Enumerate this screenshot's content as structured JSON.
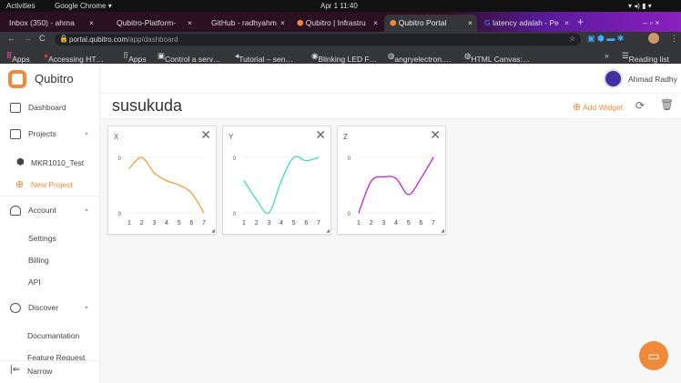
{
  "system": {
    "activities": "Activities",
    "app": "Google Chrome ▾",
    "clock": "Apr 1  11:40"
  },
  "tabs": [
    {
      "label": "Inbox (350) - ahma"
    },
    {
      "label": "Qubitro-Platform-"
    },
    {
      "label": "GitHub - radhyahm"
    },
    {
      "label": "Qubitro | Infrastru"
    },
    {
      "label": "Qubitro Portal"
    },
    {
      "label": "latency adalah - Pe"
    }
  ],
  "address": {
    "host": "portal.qubitro.com",
    "path": "/app/dashboard"
  },
  "bookmarks": [
    "Apps",
    "Accessing HT…",
    "Apps",
    "Control a serv…",
    "Tutorial – sen…",
    "Blinking LED F…",
    "angryelectron.…",
    "HTML Canvas:…"
  ],
  "reading_list": "Reading list",
  "brand": "Qubitro",
  "user": "Ahmad Radhy",
  "sidebar": {
    "dashboard": "Dashboard",
    "projects": "Projects",
    "project": "MKR1010_Test",
    "new_project": "New Project",
    "account": "Account",
    "settings": "Settings",
    "billing": "Billing",
    "api": "API",
    "discover": "Discover",
    "documentation": "Documantation",
    "feature": "Feature Request",
    "narrow": "Narrow"
  },
  "dashboard": {
    "title": "susukuda",
    "add_widget": "Add Widget"
  },
  "colors": {
    "accent": "#f08a3a"
  },
  "chart_data": [
    {
      "type": "line",
      "title": "X",
      "color": "#f0a040",
      "x": [
        1,
        2,
        3,
        4,
        5,
        6,
        7
      ],
      "values": [
        0.8,
        1.0,
        0.72,
        0.58,
        0.5,
        0.36,
        0
      ],
      "ytick_labels": [
        "0",
        "0"
      ]
    },
    {
      "type": "line",
      "title": "Y",
      "color": "#3ee0b0",
      "x": [
        1,
        2,
        3,
        4,
        5,
        6,
        7
      ],
      "values": [
        0.58,
        0.24,
        0,
        0.58,
        1.0,
        0.94,
        1.0
      ],
      "ytick_labels": [
        "0",
        "0"
      ]
    },
    {
      "type": "line",
      "title": "Z",
      "color": "#c020e0",
      "x": [
        1,
        2,
        3,
        4,
        5,
        6,
        7
      ],
      "values": [
        0,
        0.57,
        0.65,
        0.62,
        0.33,
        0.62,
        1.0
      ],
      "ytick_labels": [
        "0",
        "0"
      ]
    }
  ]
}
